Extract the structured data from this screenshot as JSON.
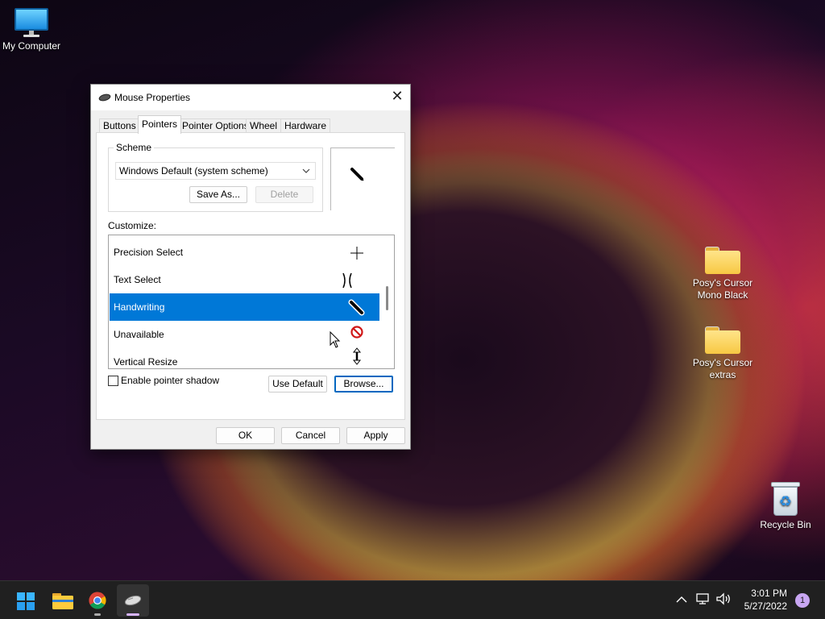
{
  "desktop": {
    "icons": [
      {
        "label": "My Computer"
      },
      {
        "label": "Posy's Cursor Mono Black"
      },
      {
        "label": "Posy's Cursor extras"
      },
      {
        "label": "Recycle Bin"
      }
    ]
  },
  "dialog": {
    "title": "Mouse Properties",
    "close_icon": "close-icon",
    "tabs": [
      {
        "label": "Buttons"
      },
      {
        "label": "Pointers"
      },
      {
        "label": "Pointer Options"
      },
      {
        "label": "Wheel"
      },
      {
        "label": "Hardware"
      }
    ],
    "active_tab": "Pointers",
    "scheme": {
      "group_label": "Scheme",
      "selected": "Windows Default (system scheme)",
      "save_as_label": "Save As...",
      "delete_label": "Delete"
    },
    "customize": {
      "label": "Customize:",
      "items": [
        {
          "label": "Precision Select",
          "icon": "crosshair-icon"
        },
        {
          "label": "Text Select",
          "icon": "text-select-icon"
        },
        {
          "label": "Handwriting",
          "icon": "pen-icon"
        },
        {
          "label": "Unavailable",
          "icon": "unavailable-icon"
        },
        {
          "label": "Vertical Resize",
          "icon": "vertical-resize-icon"
        }
      ],
      "selected": "Handwriting"
    },
    "enable_shadow_label": "Enable pointer shadow",
    "enable_shadow_checked": false,
    "use_default_label": "Use Default",
    "browse_label": "Browse...",
    "ok_label": "OK",
    "cancel_label": "Cancel",
    "apply_label": "Apply"
  },
  "taskbar": {
    "apps": [
      "start-icon",
      "file-explorer-icon",
      "chrome-icon",
      "mouse-properties-icon"
    ],
    "time": "3:01 PM",
    "date": "5/27/2022",
    "notification_count": "1"
  },
  "colors": {
    "accent": "#0078d7",
    "selection": "#0078d7",
    "taskbar": "#202020"
  }
}
